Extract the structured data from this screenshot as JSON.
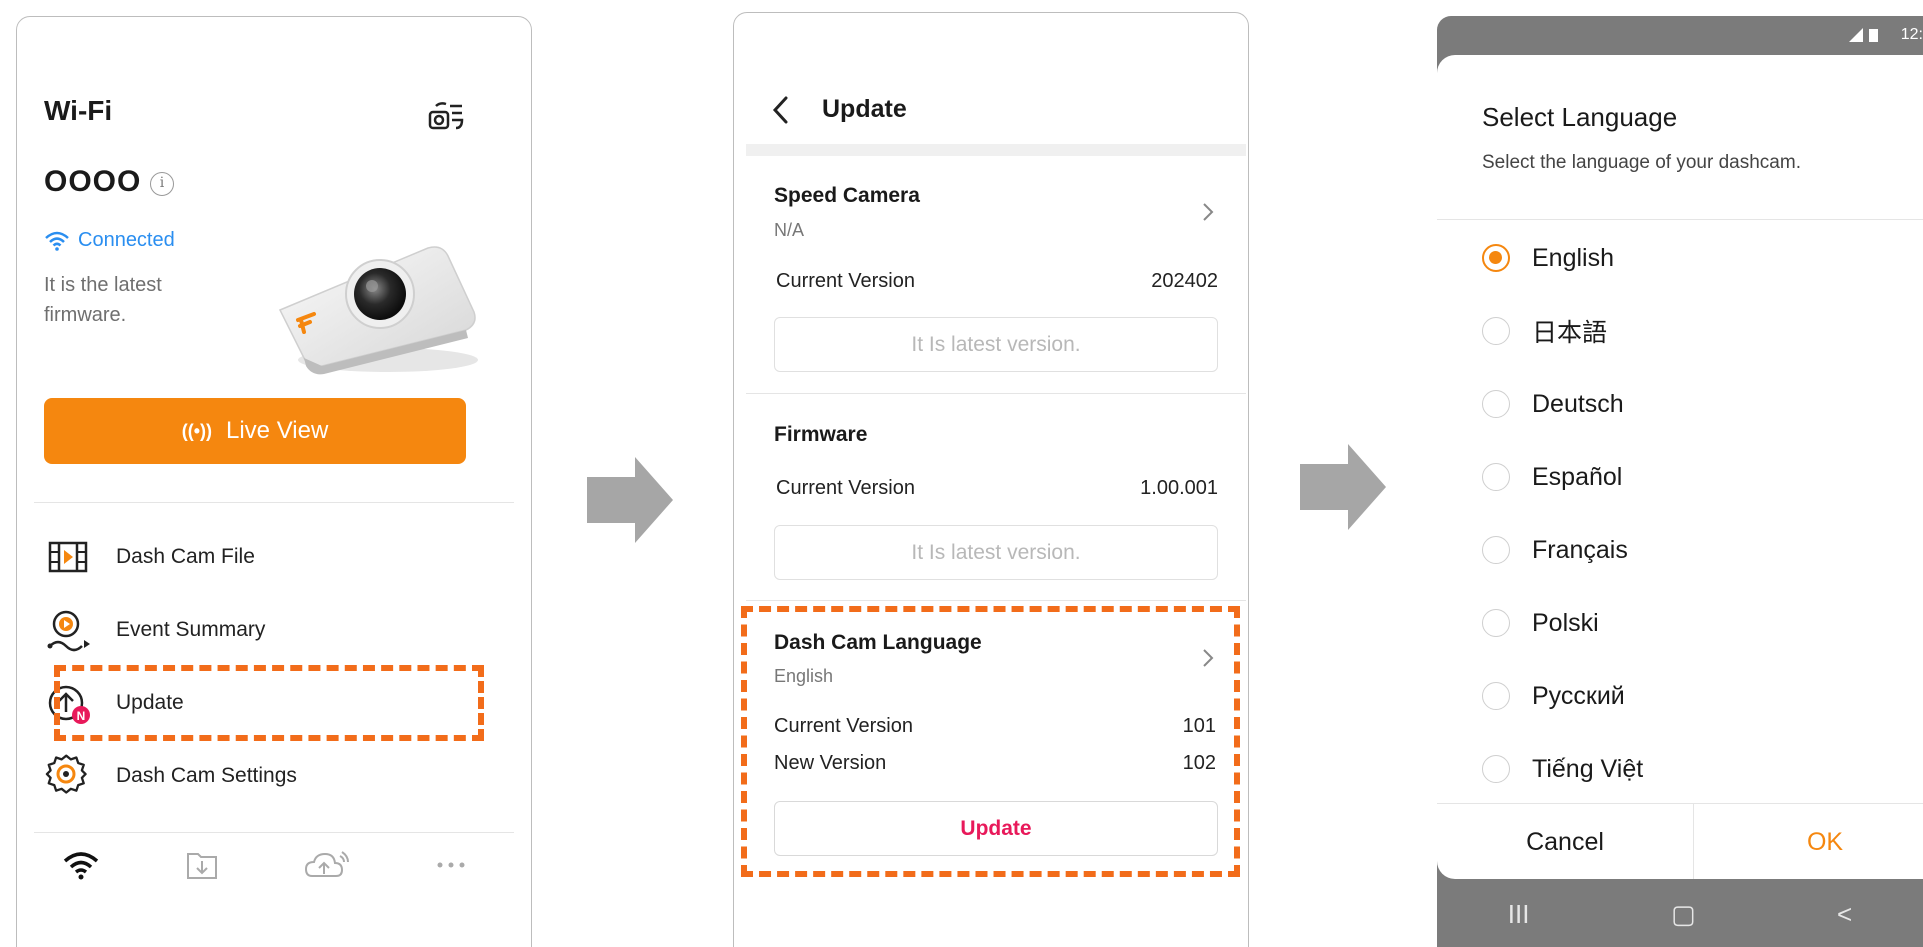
{
  "screen_wifi": {
    "title": "Wi-Fi",
    "device_name": "OOOO",
    "info_icon": "i",
    "connection_status": "Connected",
    "firmware_status": "It is the latest firmware.",
    "live_view_label": "Live View",
    "menu": [
      {
        "label": "Dash Cam File",
        "icon": "film-icon"
      },
      {
        "label": "Event Summary",
        "icon": "event-icon"
      },
      {
        "label": "Update",
        "icon": "upload-icon",
        "badge": "N"
      },
      {
        "label": "Dash Cam Settings",
        "icon": "gear-icon"
      }
    ],
    "bottom_nav": [
      "wifi-icon",
      "download-icon",
      "cloud-upload-icon",
      "more-icon"
    ],
    "colors": {
      "accent": "#f5870f",
      "connected": "#2a8ef0",
      "highlight": "#f26c1a",
      "badge": "#e8195a"
    }
  },
  "screen_update": {
    "title": "Update",
    "speed_camera": {
      "title": "Speed Camera",
      "subtitle": "N/A",
      "current_version_label": "Current Version",
      "current_version": "202402",
      "button": "It Is latest version."
    },
    "firmware": {
      "title": "Firmware",
      "current_version_label": "Current Version",
      "current_version": "1.00.001",
      "button": "It Is latest version."
    },
    "dash_cam_language": {
      "title": "Dash Cam Language",
      "subtitle": "English",
      "current_version_label": "Current Version",
      "current_version": "101",
      "new_version_label": "New Version",
      "new_version": "102",
      "button": "Update"
    }
  },
  "screen_language": {
    "status_time": "12:",
    "title": "Select Language",
    "subtitle": "Select the language of your dashcam.",
    "languages": [
      {
        "label": "English",
        "selected": true
      },
      {
        "label": "日本語",
        "selected": false
      },
      {
        "label": "Deutsch",
        "selected": false
      },
      {
        "label": "Español",
        "selected": false
      },
      {
        "label": "Français",
        "selected": false
      },
      {
        "label": "Polski",
        "selected": false
      },
      {
        "label": "Русский",
        "selected": false
      },
      {
        "label": "Tiếng Việt",
        "selected": false
      }
    ],
    "cancel_label": "Cancel",
    "ok_label": "OK",
    "nav": {
      "recents": "III",
      "home": "▢",
      "back": "<"
    }
  }
}
